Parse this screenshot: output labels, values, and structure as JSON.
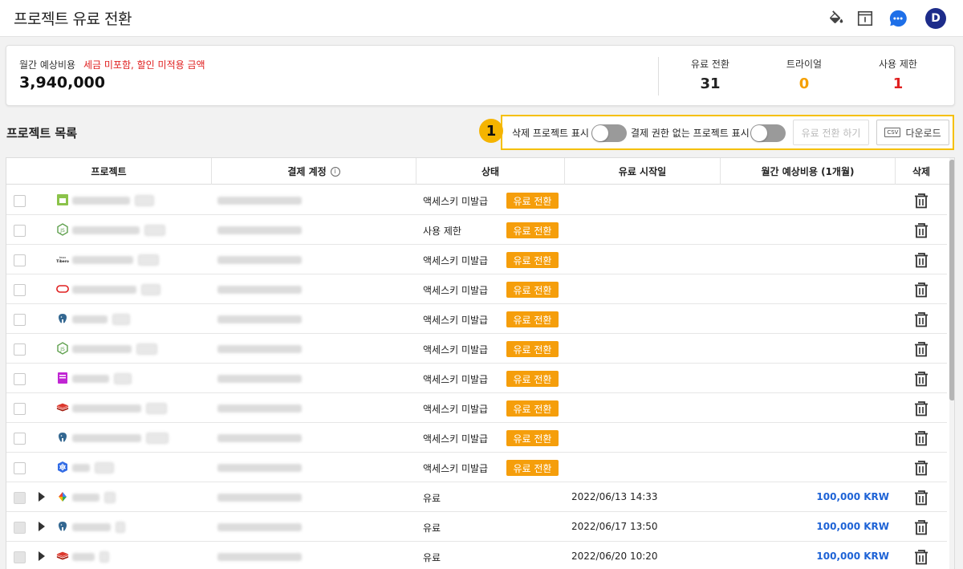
{
  "header": {
    "title": "프로젝트 유료 전환",
    "avatar_initial": "D"
  },
  "summary": {
    "label": "월간 예상비용",
    "note": "세금 미포함, 할인 미적용 금액",
    "amount": "3,940,000",
    "stats": [
      {
        "label": "유료 전환",
        "value": "31"
      },
      {
        "label": "트라이얼",
        "value": "0"
      },
      {
        "label": "사용 제한",
        "value": "1"
      }
    ]
  },
  "section": {
    "title": "프로젝트 목록",
    "badge": "1",
    "toggle_deleted_label": "삭제 프로젝트 표시",
    "toggle_nobilling_label": "결제 권한 없는 프로젝트 표시",
    "convert_button": "유료 전환 하기",
    "download_button": "다운로드",
    "csv_label": "CSV"
  },
  "table": {
    "columns": {
      "project": "프로젝트",
      "account": "결제 계정",
      "status": "상태",
      "start": "유료 시작일",
      "cost": "월간 예상비용 (1개월)",
      "delete": "삭제"
    },
    "pay_button_label": "유료 전환",
    "rows": [
      {
        "icon": "calendar-icon",
        "status": "액세스키 미발급",
        "pay": true,
        "start": "",
        "cost": ""
      },
      {
        "icon": "nodejs-icon",
        "status": "사용 제한",
        "pay": true,
        "start": "",
        "cost": ""
      },
      {
        "icon": "tibero-icon",
        "status": "액세스키 미발급",
        "pay": true,
        "start": "",
        "cost": ""
      },
      {
        "icon": "oracle-icon",
        "status": "액세스키 미발급",
        "pay": true,
        "start": "",
        "cost": ""
      },
      {
        "icon": "postgresql-icon",
        "status": "액세스키 미발급",
        "pay": true,
        "start": "",
        "cost": ""
      },
      {
        "icon": "nodejs-icon",
        "status": "액세스키 미발급",
        "pay": true,
        "start": "",
        "cost": ""
      },
      {
        "icon": "phpfpm-icon",
        "status": "액세스키 미발급",
        "pay": true,
        "start": "",
        "cost": ""
      },
      {
        "icon": "redis-icon",
        "status": "액세스키 미발급",
        "pay": true,
        "start": "",
        "cost": ""
      },
      {
        "icon": "postgresql-icon",
        "status": "액세스키 미발급",
        "pay": true,
        "start": "",
        "cost": ""
      },
      {
        "icon": "kubernetes-icon",
        "status": "액세스키 미발급",
        "pay": true,
        "start": "",
        "cost": ""
      },
      {
        "icon": "gcp-icon",
        "status": "유료",
        "pay": false,
        "start": "2022/06/13 14:33",
        "cost": "100,000 KRW"
      },
      {
        "icon": "postgresql-icon",
        "status": "유료",
        "pay": false,
        "start": "2022/06/17 13:50",
        "cost": "100,000 KRW"
      },
      {
        "icon": "redis-icon",
        "status": "유료",
        "pay": false,
        "start": "2022/06/20 10:20",
        "cost": "100,000 KRW"
      }
    ]
  },
  "colors": {
    "accent_orange": "#f59e0b",
    "trial_orange": "#f5a000",
    "limit_red": "#e02020",
    "cost_blue": "#1e63d6",
    "highlight_yellow": "#f5c000",
    "avatar_navy": "#1d2c8a"
  }
}
